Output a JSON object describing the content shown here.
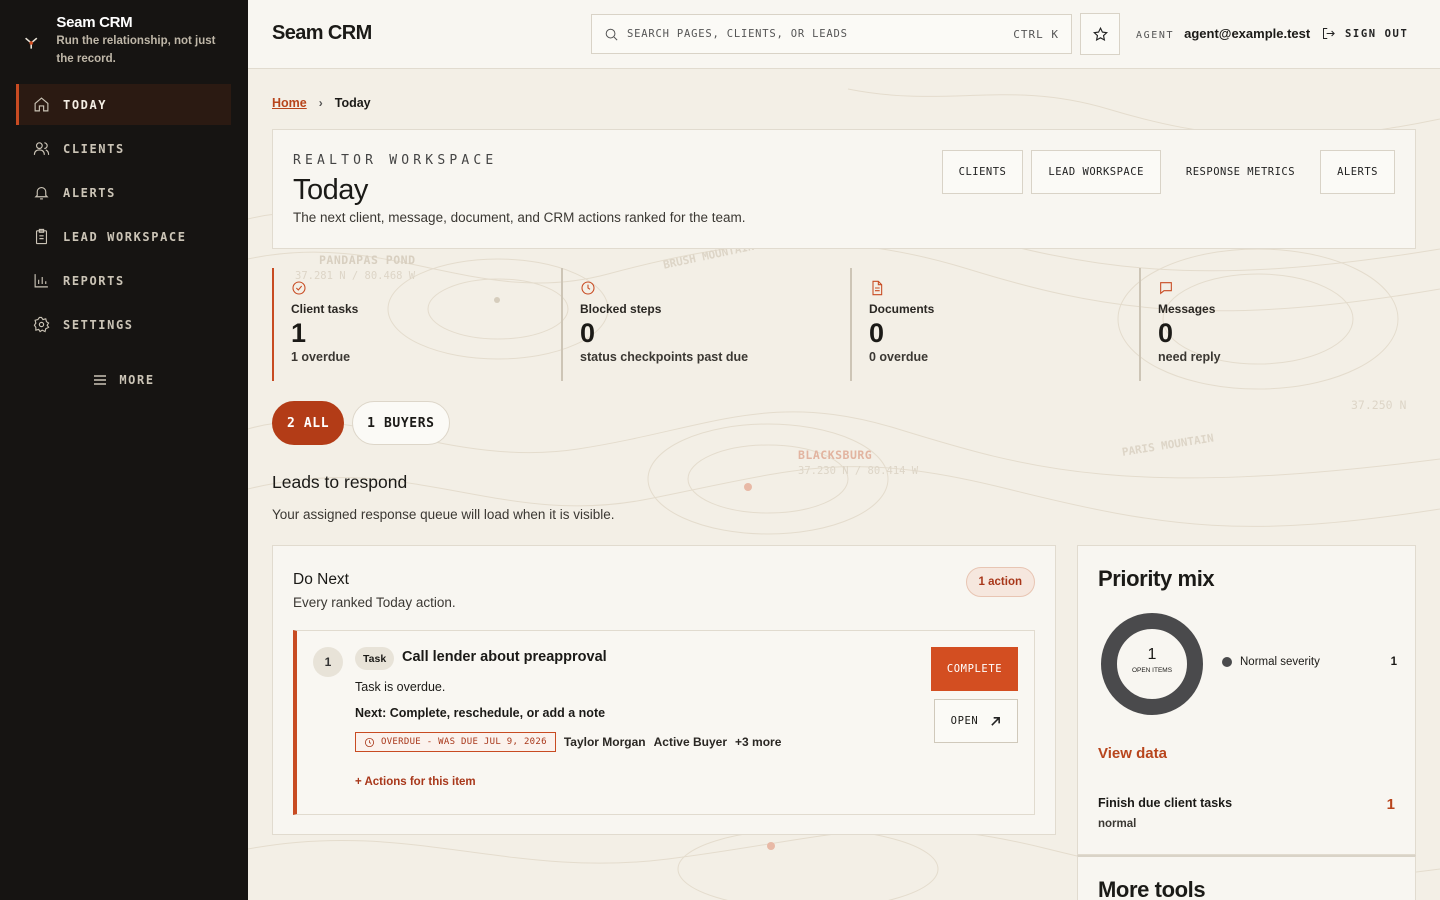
{
  "brand": {
    "name": "Seam CRM",
    "tagline": "Run the relationship, not just the record."
  },
  "nav": {
    "items": [
      {
        "label": "TODAY",
        "icon": "home-icon",
        "active": true
      },
      {
        "label": "CLIENTS",
        "icon": "users-icon"
      },
      {
        "label": "ALERTS",
        "icon": "bell-icon"
      },
      {
        "label": "LEAD WORKSPACE",
        "icon": "clipboard-icon"
      },
      {
        "label": "REPORTS",
        "icon": "bar-chart-icon"
      },
      {
        "label": "SETTINGS",
        "icon": "gear-icon"
      }
    ],
    "more_label": "MORE"
  },
  "topbar": {
    "title": "Seam CRM",
    "search_placeholder": "SEARCH PAGES, CLIENTS, OR LEADS",
    "search_shortcut": "CTRL K",
    "agent_label": "AGENT",
    "agent_email": "agent@example.test",
    "signout_label": "SIGN OUT"
  },
  "breadcrumb": {
    "home": "Home",
    "current": "Today"
  },
  "header": {
    "eyebrow": "REALTOR WORKSPACE",
    "title": "Today",
    "subtitle": "The next client, message, document, and CRM actions ranked for the team.",
    "quick_links": [
      "CLIENTS",
      "LEAD WORKSPACE",
      "RESPONSE METRICS",
      "ALERTS"
    ]
  },
  "map_labels": {
    "pandapas": "PANDAPAS POND",
    "pandapas_coord": "37.281 N / 80.468 W",
    "brush": "BRUSH MOUNTAIN",
    "blacksburg": "BLACKSBURG",
    "blacksburg_coord": "37.230 N / 80.414 W",
    "paris": "PARIS MOUNTAIN",
    "lat": "37.250 N"
  },
  "stats": [
    {
      "label": "Client tasks",
      "value": "1",
      "note": "1 overdue",
      "icon": "check-circle-icon"
    },
    {
      "label": "Blocked steps",
      "value": "0",
      "note": "status checkpoints past due",
      "icon": "clock-icon"
    },
    {
      "label": "Documents",
      "value": "0",
      "note": "0 overdue",
      "icon": "document-icon"
    },
    {
      "label": "Messages",
      "value": "0",
      "note": "need reply",
      "icon": "message-icon"
    }
  ],
  "filters": [
    {
      "label": "2 ALL",
      "active": true
    },
    {
      "label": "1 BUYERS",
      "active": false
    }
  ],
  "leads": {
    "title": "Leads to respond",
    "subtitle": "Your assigned response queue will load when it is visible."
  },
  "do_next": {
    "title": "Do Next",
    "subtitle": "Every ranked Today action.",
    "badge": "1 action",
    "item": {
      "rank": "1",
      "tag": "Task",
      "title": "Call lender about preapproval",
      "description": "Task is overdue.",
      "next": "Next: Complete, reschedule, or add a note",
      "overdue": "OVERDUE - WAS DUE JUL 9, 2026",
      "client": "Taylor Morgan",
      "stage": "Active Buyer",
      "more": "+3 more",
      "actions_link": "+ Actions for this item",
      "complete_label": "COMPLETE",
      "open_label": "OPEN"
    }
  },
  "priority_mix": {
    "title": "Priority mix",
    "total": "1",
    "total_label": "OPEN ITEMS",
    "legend": [
      {
        "label": "Normal severity",
        "value": "1",
        "color": "#4a4a4c"
      }
    ],
    "view_data": "View data",
    "item_title": "Finish due client tasks",
    "item_sub": "normal",
    "item_count": "1"
  },
  "more_tools": {
    "title": "More tools"
  },
  "colors": {
    "accent": "#c84b22",
    "sidebar": "#161412",
    "background": "#f3efe6"
  }
}
